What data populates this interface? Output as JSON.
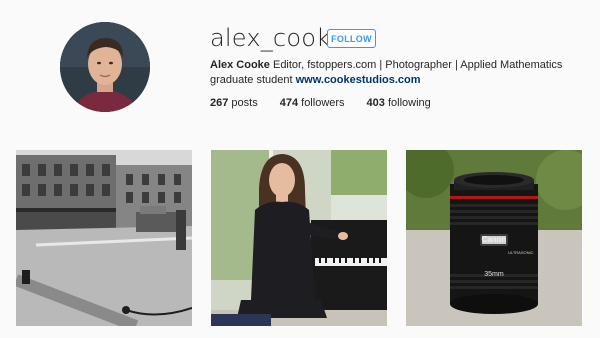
{
  "profile": {
    "username": "alex_cooke",
    "follow_label": "FOLLOW",
    "full_name": "Alex Cooke",
    "bio_text": " Editor, fstoppers.com | Photographer | Applied Mathematics graduate student ",
    "website": "www.cookestudios.com"
  },
  "stats": {
    "posts_count": "267",
    "posts_label": " posts",
    "followers_count": "474",
    "followers_label": " followers",
    "following_count": "403",
    "following_label": " following"
  },
  "posts": [
    {
      "icon": "street-photo"
    },
    {
      "icon": "pianist-photo"
    },
    {
      "icon": "lens-photo",
      "lens_brand": "Canon",
      "lens_focal": "35mm",
      "lens_series": "ULTRASONIC"
    }
  ],
  "colors": {
    "accent": "#3897f0",
    "link": "#003569",
    "background": "#fafafa"
  }
}
